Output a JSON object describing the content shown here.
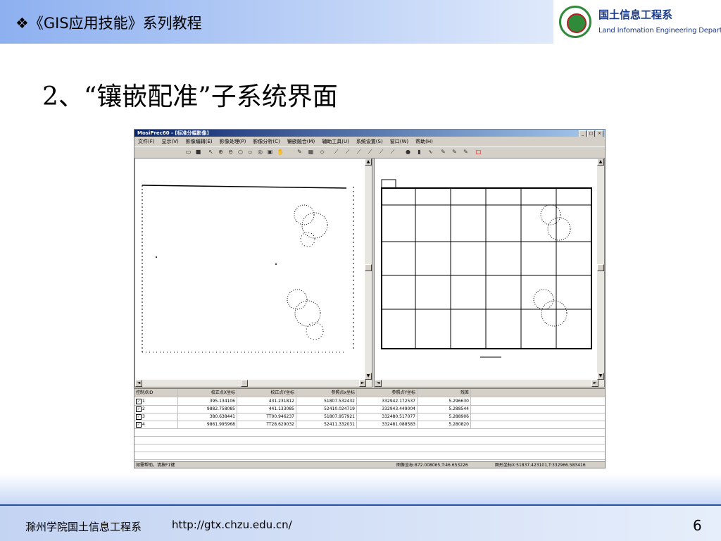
{
  "header": {
    "title": "❖《GIS应用技能》系列教程"
  },
  "logo": {
    "cn": "国土信息工程系",
    "en": "Land Infomation Engineering Department"
  },
  "slide": {
    "title": "2、“镶嵌配准”子系统界面"
  },
  "app": {
    "window_title": "MosiPrec60 - [标准分幅影像]",
    "menu": [
      "文件(F)",
      "显示(V)",
      "影像编辑(E)",
      "影像处理(P)",
      "影像分析(C)",
      "镶嵌融合(M)",
      "辅助工具(U)",
      "系统设置(S)",
      "窗口(W)",
      "帮助(H)"
    ],
    "table": {
      "headers": [
        "控制点ID",
        "校正点X坐标",
        "校正点Y坐标",
        "参照点x坐标",
        "参照点Y坐标",
        "残差"
      ],
      "rows": [
        [
          "1",
          "395.134106",
          "431.231812",
          "51807.532432",
          "332942.172537",
          "5.296630"
        ],
        [
          "2",
          "9882.758085",
          "441.133085",
          "52410.024719",
          "332943.449004",
          "5.288544"
        ],
        [
          "3",
          "380.638441",
          "TT00.946237",
          "51807.957921",
          "332480.517077",
          "5.288906"
        ],
        [
          "4",
          "9861.995968",
          "TT28.629032",
          "52411.332031",
          "332481.088583",
          "5.280820"
        ]
      ]
    },
    "status": {
      "help": "如需帮助，请按F1键",
      "image_coord": "图像坐标:872.008065,T:46.653226",
      "map_coord": "图形坐标X:51837.423101,T:332966.583416"
    }
  },
  "footer": {
    "school": "滁州学院国土信息工程系",
    "url": "http://gtx.chzu.edu.cn/",
    "page": "6"
  }
}
